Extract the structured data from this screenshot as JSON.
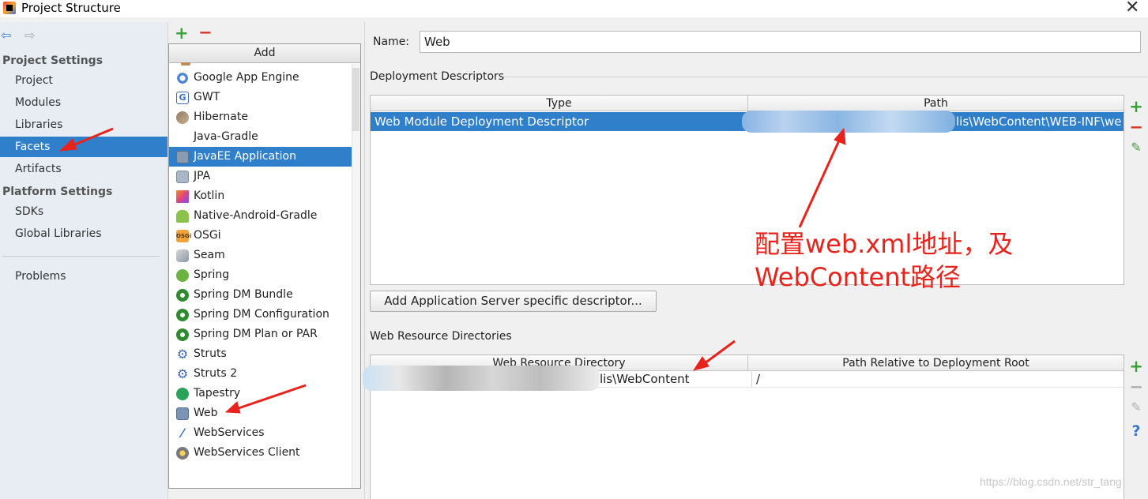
{
  "window": {
    "title": "Project Structure",
    "close_glyph": "✕"
  },
  "nav": {
    "back_glyph": "⇦",
    "forward_glyph": "⇨",
    "project_settings": "Project Settings",
    "items": [
      "Project",
      "Modules",
      "Libraries",
      "Facets",
      "Artifacts"
    ],
    "platform_settings": "Platform Settings",
    "platform_items": [
      "SDKs",
      "Global Libraries"
    ],
    "problems": "Problems"
  },
  "middle": {
    "add_glyph": "+",
    "remove_glyph": "−",
    "popup_title": "Add",
    "items": [
      "Google App Engine",
      "GWT",
      "Hibernate",
      "Java-Gradle",
      "JavaEE Application",
      "JPA",
      "Kotlin",
      "Native-Android-Gradle",
      "OSGi",
      "Seam",
      "Spring",
      "Spring DM Bundle",
      "Spring DM Configuration",
      "Spring DM Plan or PAR",
      "Struts",
      "Struts 2",
      "Tapestry",
      "Web",
      "WebServices",
      "WebServices Client"
    ],
    "icon_glyphs": {
      "gwt": "G",
      "osgi": "OSGi",
      "struts": "⚙",
      "webservices": "⁄"
    }
  },
  "detail": {
    "name_label": "Name:",
    "name_value": "Web",
    "deployment_descriptors": "Deployment Descriptors",
    "dd_columns": [
      "Type",
      "Path"
    ],
    "dd_row": {
      "type": "Web Module Deployment Descriptor",
      "path_visible": "lis\\WebContent\\WEB-INF\\we"
    },
    "add_server_button": "Add Application Server specific descriptor...",
    "web_resource_directories": "Web Resource Directories",
    "wr_columns": [
      "Web Resource Directory",
      "Path Relative to Deployment Root"
    ],
    "wr_row": {
      "directory_visible": "lis\\WebContent",
      "relative_path": "/"
    },
    "tool_glyphs": {
      "add": "+",
      "remove": "−",
      "edit": "✎",
      "help": "?"
    }
  },
  "annotation": {
    "line1": "配置web.xml地址，及",
    "line2": "WebContent路径",
    "color": "#e8231b"
  },
  "watermark": "https://blog.csdn.net/str_tang",
  "colors": {
    "selection": "#2f7fcb",
    "nav_background": "#e7edf3",
    "add_green": "#3ca13c",
    "remove_red": "#d33a2c"
  }
}
